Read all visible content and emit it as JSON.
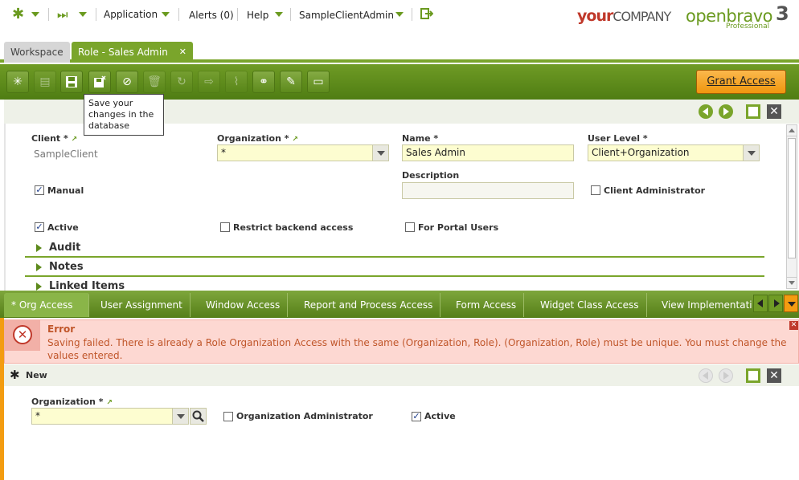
{
  "topnav": {
    "application": "Application",
    "alerts": "Alerts (0)",
    "help": "Help",
    "user": "SampleClientAdmin",
    "brand_your": "your",
    "brand_company": "COMPANY",
    "brand_ob": "openbravo",
    "brand_ob_sub": "Professional",
    "brand_version": "3"
  },
  "window_tabs": [
    {
      "label": "Workspace"
    },
    {
      "label": "Role - Sales Admin"
    }
  ],
  "toolbar": {
    "grant_access": "Grant Access",
    "tooltip": "Save your changes in the database"
  },
  "form": {
    "client_label": "Client *",
    "client_value": "SampleClient",
    "org_label": "Organization *",
    "org_value": "*",
    "name_label": "Name *",
    "name_value": "Sales Admin",
    "userlevel_label": "User Level *",
    "userlevel_value": "Client+Organization",
    "description_label": "Description",
    "description_value": "",
    "manual_label": "Manual",
    "manual_checked": true,
    "client_admin_label": "Client Administrator",
    "client_admin_checked": false,
    "active_label": "Active",
    "active_checked": true,
    "restrict_label": "Restrict backend access",
    "restrict_checked": false,
    "portal_label": "For Portal Users",
    "portal_checked": false
  },
  "sections": [
    {
      "label": "Audit"
    },
    {
      "label": "Notes"
    },
    {
      "label": "Linked Items"
    }
  ],
  "child_tabs": [
    {
      "label": "* Org Access"
    },
    {
      "label": "User Assignment"
    },
    {
      "label": "Window Access"
    },
    {
      "label": "Report and Process Access"
    },
    {
      "label": "Form Access"
    },
    {
      "label": "Widget Class Access"
    },
    {
      "label": "View Implementati"
    }
  ],
  "error": {
    "title": "Error",
    "message": "Saving failed. There is already a Role Organization Access with the same (Organization, Role). (Organization, Role) must be unique. You must change the values entered."
  },
  "child_form": {
    "status": "New",
    "org_label": "Organization *",
    "org_value": "*",
    "org_admin_label": "Organization Administrator",
    "org_admin_checked": false,
    "active_label": "Active",
    "active_checked": true
  },
  "colors": {
    "green": "#5d8a1c",
    "orange": "#f39c11",
    "error_text": "#c0562a"
  }
}
